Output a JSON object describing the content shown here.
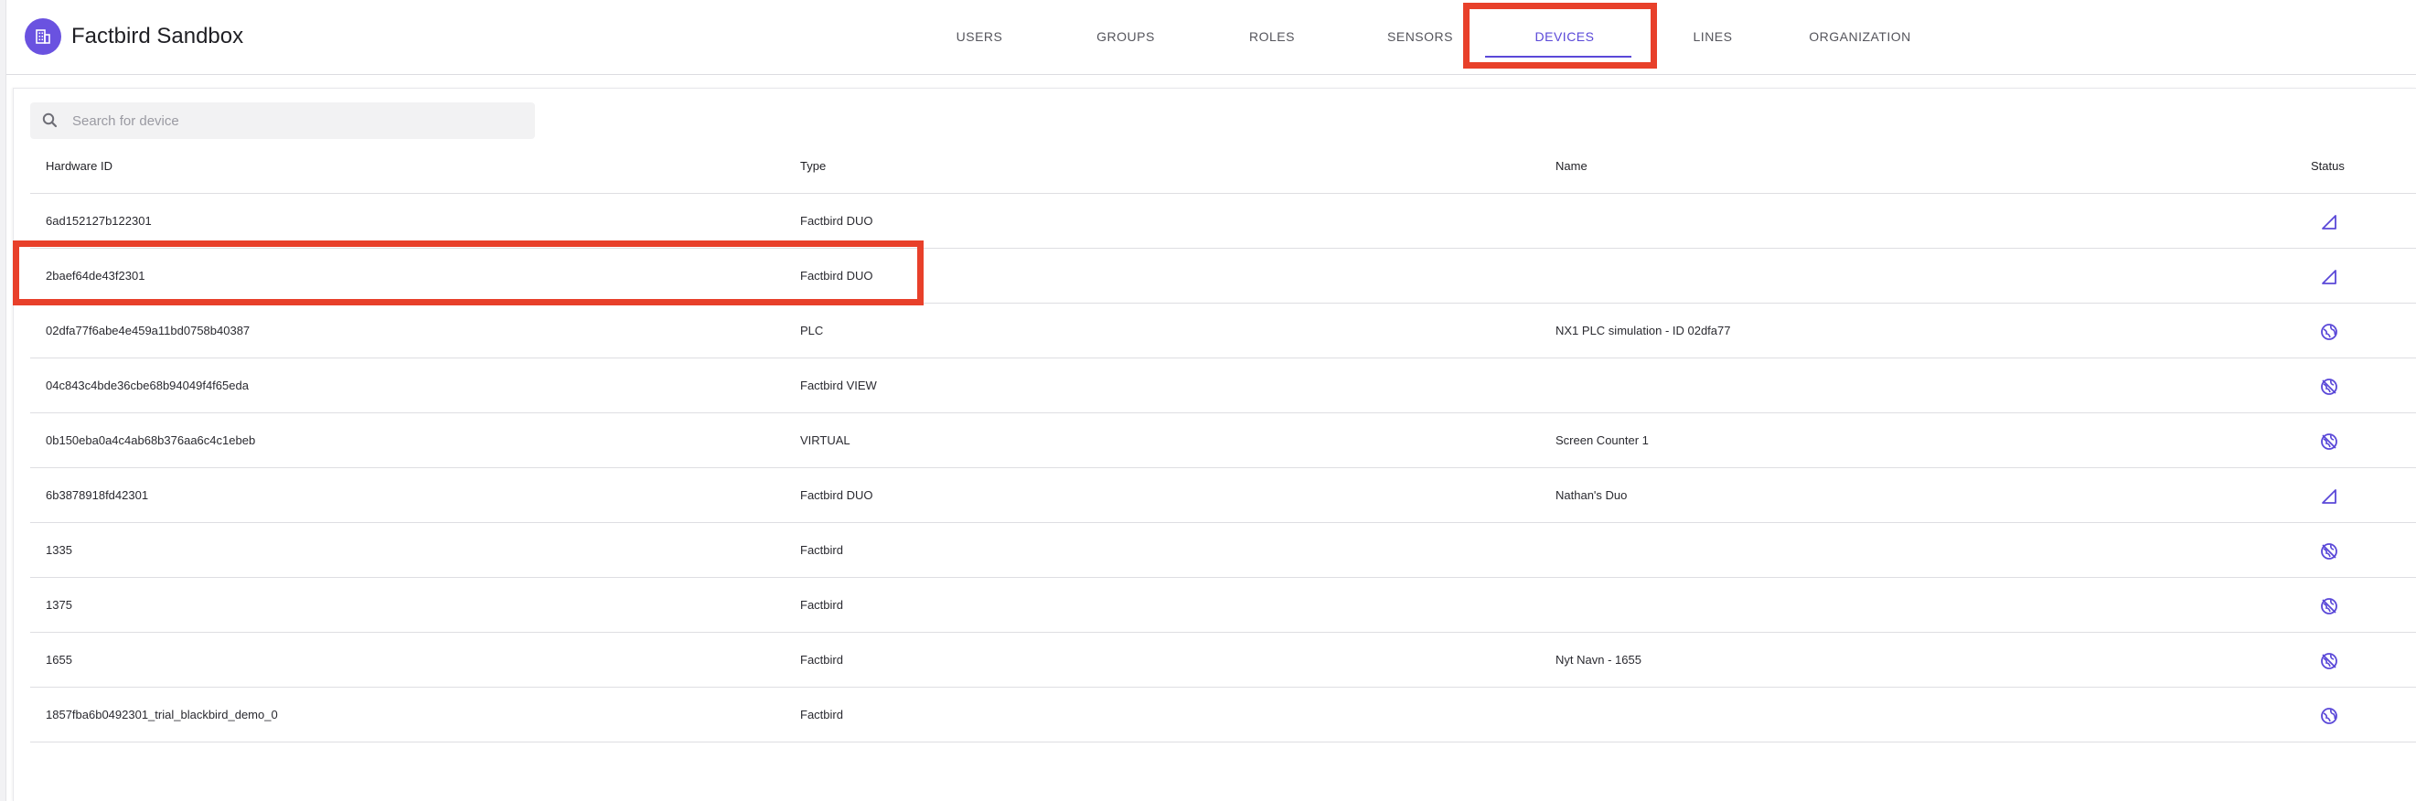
{
  "header": {
    "app_title": "Factbird Sandbox",
    "tabs": [
      {
        "label": "USERS",
        "active": false
      },
      {
        "label": "GROUPS",
        "active": false
      },
      {
        "label": "ROLES",
        "active": false
      },
      {
        "label": "SENSORS",
        "active": false
      },
      {
        "label": "DEVICES",
        "active": true
      },
      {
        "label": "LINES",
        "active": false
      },
      {
        "label": "ORGANIZATION",
        "active": false
      }
    ]
  },
  "search": {
    "placeholder": "Search for device",
    "value": ""
  },
  "table": {
    "headers": {
      "hardware_id": "Hardware ID",
      "type": "Type",
      "name": "Name",
      "status": "Status"
    },
    "rows": [
      {
        "hardware_id": "6ad152127b122301",
        "type": "Factbird DUO",
        "name": "",
        "status_icon": "signal-icon"
      },
      {
        "hardware_id": "2baef64de43f2301",
        "type": "Factbird DUO",
        "name": "",
        "status_icon": "signal-icon"
      },
      {
        "hardware_id": "02dfa77f6abe4e459a11bd0758b40387",
        "type": "PLC",
        "name": "NX1 PLC simulation - ID 02dfa77",
        "status_icon": "globe-icon"
      },
      {
        "hardware_id": "04c843c4bde36cbe68b94049f4f65eda",
        "type": "Factbird VIEW",
        "name": "",
        "status_icon": "globe-off-icon"
      },
      {
        "hardware_id": "0b150eba0a4c4ab68b376aa6c4c1ebeb",
        "type": "VIRTUAL",
        "name": "Screen Counter 1",
        "status_icon": "globe-off-icon"
      },
      {
        "hardware_id": "6b3878918fd42301",
        "type": "Factbird DUO",
        "name": "Nathan's Duo",
        "status_icon": "signal-icon"
      },
      {
        "hardware_id": "1335",
        "type": "Factbird",
        "name": "",
        "status_icon": "globe-off-icon"
      },
      {
        "hardware_id": "1375",
        "type": "Factbird",
        "name": "",
        "status_icon": "globe-off-icon"
      },
      {
        "hardware_id": "1655",
        "type": "Factbird",
        "name": "Nyt Navn - 1655",
        "status_icon": "globe-off-icon"
      },
      {
        "hardware_id": "1857fba6b0492301_trial_blackbird_demo_0",
        "type": "Factbird",
        "name": "",
        "status_icon": "globe-icon"
      }
    ]
  },
  "colors": {
    "accent": "#5a48d8",
    "logo": "#6a52e0",
    "highlight": "#e8402a"
  }
}
